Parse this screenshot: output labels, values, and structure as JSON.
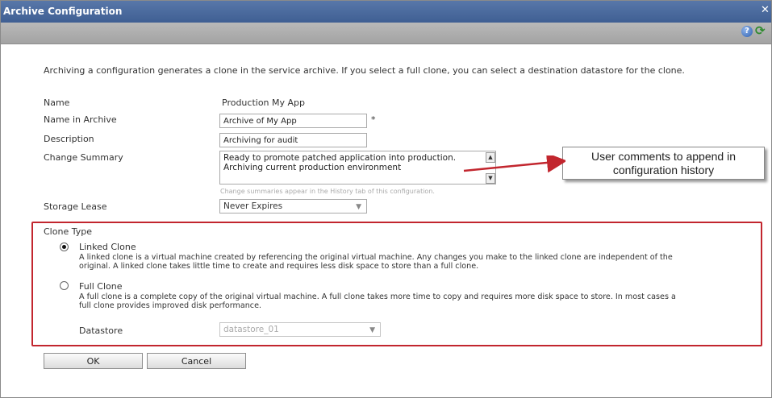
{
  "window": {
    "title": "Archive Configuration",
    "close_glyph": "✕"
  },
  "toolbar": {
    "help_icon": "help-icon",
    "refresh_icon": "refresh-icon"
  },
  "intro": "Archiving a configuration generates a clone in the service archive. If you select a full clone, you can select a destination datastore for the clone.",
  "form": {
    "name_label": "Name",
    "name_value": "Production My App",
    "archive_name_label": "Name in Archive",
    "archive_name_value": "Archive of My App",
    "required_mark": "*",
    "description_label": "Description",
    "description_value": "Archiving for audit",
    "change_summary_label": "Change Summary",
    "change_summary_line1": "Ready to promote patched application into production.",
    "change_summary_line2": "Archiving current production environment",
    "change_summary_hint": "Change summaries appear in the History tab of this configuration.",
    "storage_lease_label": "Storage Lease",
    "storage_lease_value": "Never Expires"
  },
  "callout": {
    "line1": "User comments to append in",
    "line2": "configuration history",
    "color": "#c2262e"
  },
  "clone_type": {
    "title": "Clone Type",
    "options": [
      {
        "label": "Linked Clone",
        "checked": true,
        "desc_line1": "A linked clone is a virtual machine created by referencing the original virtual machine. Any changes you make to the linked clone are independent of the",
        "desc_line2": "original. A linked clone takes little time to create and requires less disk space to store than a full clone."
      },
      {
        "label": "Full Clone",
        "checked": false,
        "desc_line1": "A full clone is a complete copy of the original virtual machine. A full clone takes more time to copy and requires more disk space to store. In most cases a",
        "desc_line2": "full clone provides improved disk performance."
      }
    ],
    "datastore_label": "Datastore",
    "datastore_value": "datastore_01"
  },
  "buttons": {
    "ok": "OK",
    "cancel": "Cancel"
  }
}
